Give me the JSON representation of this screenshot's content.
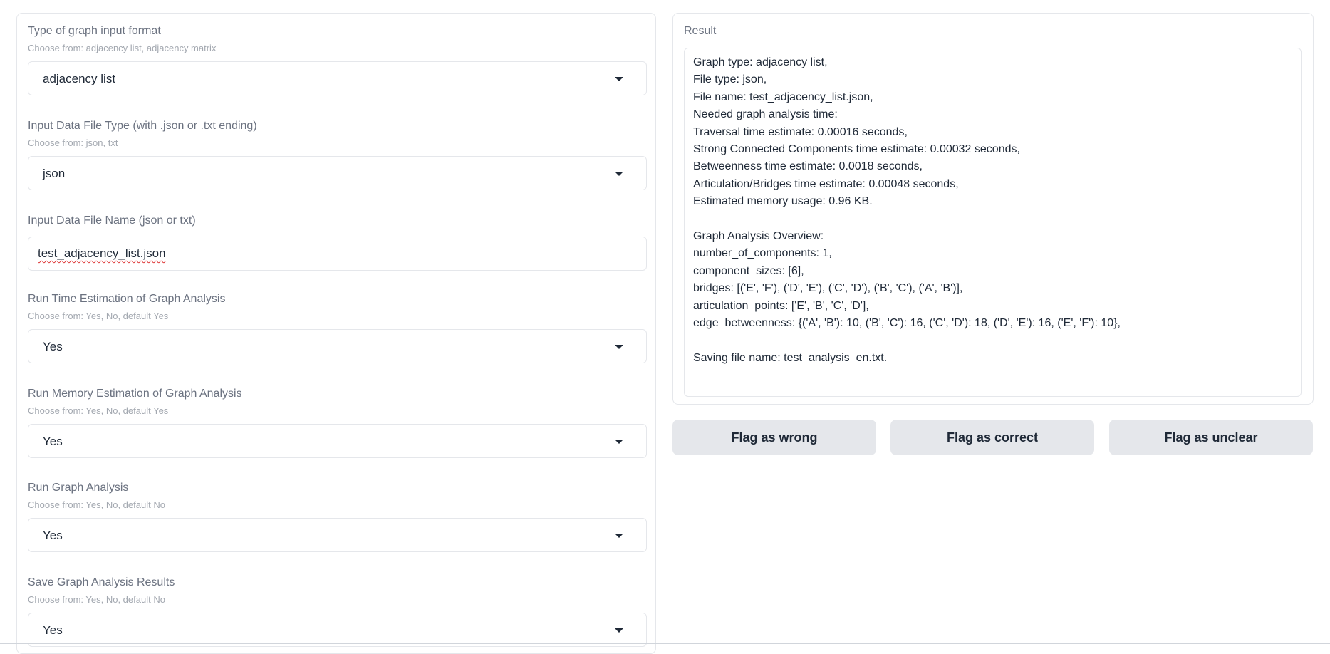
{
  "form": {
    "graph_format": {
      "label": "Type of graph input format",
      "info": "Choose from: adjacency list, adjacency matrix",
      "value": "adjacency list"
    },
    "file_type": {
      "label": "Input Data File Type (with .json or .txt ending)",
      "info": "Choose from: json, txt",
      "value": "json"
    },
    "file_name": {
      "label": "Input Data File Name (json or txt)",
      "value": "test_adjacency_list.json"
    },
    "time_estimation": {
      "label": "Run Time Estimation of Graph Analysis",
      "info": "Choose from: Yes, No, default Yes",
      "value": "Yes"
    },
    "memory_estimation": {
      "label": "Run Memory Estimation of Graph Analysis",
      "info": "Choose from: Yes, No, default Yes",
      "value": "Yes"
    },
    "graph_analysis": {
      "label": "Run Graph Analysis",
      "info": "Choose from: Yes, No, default No",
      "value": "Yes"
    },
    "save_results": {
      "label": "Save Graph Analysis Results",
      "info": "Choose from: Yes, No, default No",
      "value": "Yes"
    }
  },
  "result": {
    "label": "Result",
    "lines": [
      "Graph type: adjacency list,",
      "File type: json,",
      "File name: test_adjacency_list.json,",
      "Needed graph analysis time:",
      "Traversal time estimate: 0.00016 seconds,",
      "Strong Connected Components time estimate: 0.00032 seconds,",
      "Betweenness time estimate: 0.0018 seconds,",
      "Articulation/Bridges time estimate: 0.00048 seconds,",
      "Estimated memory usage: 0.96 KB.",
      "______________________________________________________",
      "Graph Analysis Overview:",
      "number_of_components: 1,",
      "component_sizes: [6],",
      "bridges: [('E', 'F'), ('D', 'E'), ('C', 'D'), ('B', 'C'), ('A', 'B')],",
      "articulation_points: ['E', 'B', 'C', 'D'],",
      "edge_betweenness: {('A', 'B'): 10, ('B', 'C'): 16, ('C', 'D'): 18, ('D', 'E'): 16, ('E', 'F'): 10},",
      "______________________________________________________",
      "Saving file name: test_analysis_en.txt."
    ]
  },
  "buttons": {
    "flag_wrong": "Flag as wrong",
    "flag_correct": "Flag as correct",
    "flag_unclear": "Flag as unclear"
  }
}
